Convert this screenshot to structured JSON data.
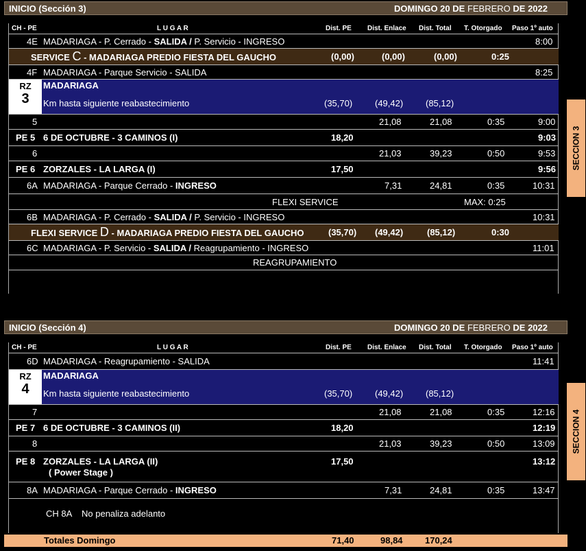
{
  "sections": [
    {
      "header_left": "INICIO (Sección 3)",
      "header_day": "DOMINGO 20 DE",
      "header_month": "FEBRERO",
      "header_year": "DE 2022",
      "side_tab": "SECCION 3"
    },
    {
      "header_left": "INICIO (Sección 4)",
      "header_day": "DOMINGO 20 DE",
      "header_month": "FEBRERO",
      "header_year": "DE 2022",
      "side_tab": "SECCION 4"
    }
  ],
  "columns": {
    "ch": "CH - PE",
    "lugar": "L U G A R",
    "dist_pe": "Dist. PE",
    "dist_enlace": "Dist. Enlace",
    "dist_total": "Dist. Total",
    "t_otorgado": "T. Otorgado",
    "paso": "Paso 1º auto"
  },
  "s3": {
    "r4e": {
      "ch": "4E",
      "a": "MADARIAGA - P. Cerrado - ",
      "b": "SALIDA /",
      "c": " P. Servicio - INGRESO",
      "paso": "8:00"
    },
    "svc": {
      "label": "SERVICE",
      "symbol": "C",
      "text": "- MADARIAGA PREDIO FIESTA DEL GAUCHO",
      "pe": "(0,00)",
      "enl": "(0,00)",
      "tot": "(0,00)",
      "t": "0:25"
    },
    "r4f": {
      "ch": "4F",
      "text": "MADARIAGA - Parque Servicio - SALIDA",
      "paso": "8:25"
    },
    "rz": {
      "rz": "RZ",
      "num": "3",
      "title": "MADARIAGA",
      "sub": "Km hasta siguiente reabastecimiento",
      "pe": "(35,70)",
      "enl": "(49,42)",
      "tot": "(85,12)"
    },
    "r5": {
      "ch": "5",
      "enl": "21,08",
      "tot": "21,08",
      "t": "0:35",
      "paso": "9:00"
    },
    "pe5": {
      "ch": "PE 5",
      "text": "6 DE OCTUBRE - 3 CAMINOS (I)",
      "pe": "18,20",
      "paso": "9:03"
    },
    "r6": {
      "ch": "6",
      "enl": "21,03",
      "tot": "39,23",
      "t": "0:50",
      "paso": "9:53"
    },
    "pe6": {
      "ch": "PE 6",
      "text": "ZORZALES - LA LARGA (I)",
      "pe": "17,50",
      "paso": "9:56"
    },
    "r6a": {
      "ch": "6A",
      "a": "MADARIAGA - Parque Cerrado - ",
      "b": "INGRESO",
      "enl": "7,31",
      "tot": "24,81",
      "t": "0:35",
      "paso": "10:31"
    },
    "flexi": {
      "text": "FLEXI SERVICE",
      "max": "MAX: 0:25"
    },
    "r6b": {
      "ch": "6B",
      "a": "MADARIAGA - P. Cerrado - ",
      "b": "SALIDA /",
      "c": " P. Servicio - INGRESO",
      "paso": "10:31"
    },
    "svc2": {
      "label": "FLEXI SERVICE",
      "symbol": "D",
      "text": "- MADARIAGA PREDIO FIESTA DEL GAUCHO",
      "pe": "(35,70)",
      "enl": "(49,42)",
      "tot": "(85,12)",
      "t": "0:30"
    },
    "r6c": {
      "ch": "6C",
      "a": "MADARIAGA - P. Servicio - ",
      "b": "SALIDA /",
      "c": " Reagrupamiento - INGRESO",
      "paso": "11:01"
    },
    "reag": "REAGRUPAMIENTO"
  },
  "s4": {
    "r6d": {
      "ch": "6D",
      "text": "MADARIAGA - Reagrupamiento - SALIDA",
      "paso": "11:41"
    },
    "rz": {
      "rz": "RZ",
      "num": "4",
      "title": "MADARIAGA",
      "sub": "Km hasta siguiente reabastecimiento",
      "pe": "(35,70)",
      "enl": "(49,42)",
      "tot": "(85,12)"
    },
    "r7": {
      "ch": "7",
      "enl": "21,08",
      "tot": "21,08",
      "t": "0:35",
      "paso": "12:16"
    },
    "pe7": {
      "ch": "PE 7",
      "text": "6 DE OCTUBRE - 3 CAMINOS (II)",
      "pe": "18,20",
      "paso": "12:19"
    },
    "r8": {
      "ch": "8",
      "enl": "21,03",
      "tot": "39,23",
      "t": "0:50",
      "paso": "13:09"
    },
    "pe8": {
      "ch": "PE 8",
      "text": "ZORZALES - LA LARGA (II)",
      "text2": "( Power Stage )",
      "pe": "17,50",
      "paso": "13:12"
    },
    "r8a": {
      "ch": "8A",
      "a": "MADARIAGA - Parque Cerrado - ",
      "b": "INGRESO",
      "enl": "7,31",
      "tot": "24,81",
      "t": "0:35",
      "paso": "13:47"
    },
    "note": {
      "ch": "CH 8A",
      "text": "No penaliza adelanto"
    }
  },
  "totals": {
    "label": "Totales Domingo",
    "pe": "71,40",
    "enl": "98,84",
    "tot": "170,24"
  }
}
